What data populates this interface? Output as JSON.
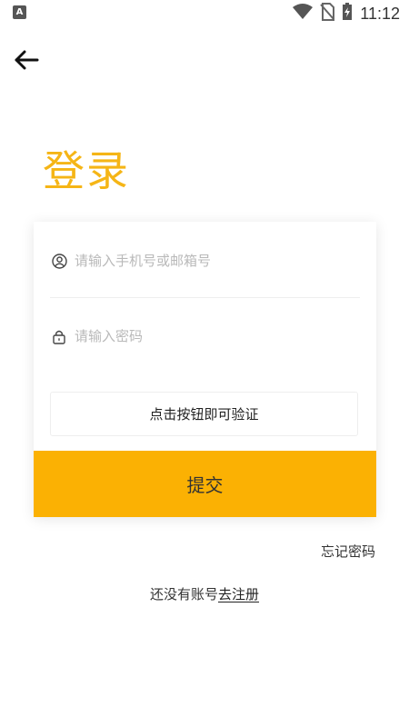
{
  "status_bar": {
    "app_icon_letter": "A",
    "time": "11:12",
    "icons": [
      "app-notification-icon",
      "wifi-icon",
      "no-sim-icon",
      "battery-charging-icon"
    ]
  },
  "header": {
    "back_icon": "arrow-left-icon",
    "title": "登录"
  },
  "form": {
    "account": {
      "placeholder": "请输入手机号或邮箱号",
      "value": "",
      "icon": "user-circle-icon"
    },
    "password": {
      "placeholder": "请输入密码",
      "value": "",
      "icon": "lock-icon"
    },
    "verify_label": "点击按钮即可验证",
    "submit_label": "提交"
  },
  "links": {
    "forgot_password": "忘记密码",
    "no_account_text": "还没有账号",
    "register_label": "去注册"
  },
  "colors": {
    "accent": "#fbb103",
    "title": "#f5b516"
  }
}
